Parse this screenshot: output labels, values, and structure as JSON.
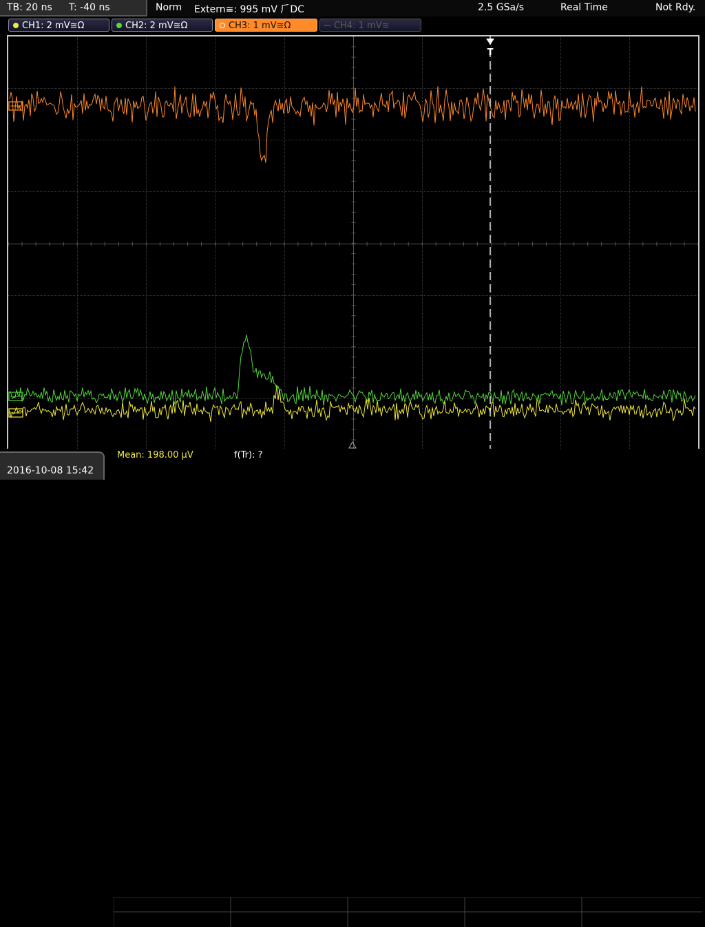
{
  "topbar": {
    "timebase": "TB: 20 ns",
    "trigger_pos": "T: -40 ns",
    "mode": "Norm",
    "trigger_source": "Extern≅: 995 mV ⺁DC",
    "sample_rate": "2.5 GSa/s",
    "acq_mode": "Real Time",
    "status": "Not Rdy."
  },
  "channels": [
    {
      "label": "CH1: 2 mV≅Ω",
      "color": "#f2ea3c",
      "state": "on"
    },
    {
      "label": "CH2: 2 mV≅Ω",
      "color": "#52d93a",
      "state": "on"
    },
    {
      "label": "CH3: 1 mV≅Ω",
      "color": "#ff8a2a",
      "state": "active"
    },
    {
      "label": "CH4: 1 mV≅",
      "color": "#5a5a60",
      "state": "off"
    }
  ],
  "trigger_marker": "T",
  "measurements": {
    "mean": "Mean: 198.00 µV",
    "ftr": "f(Tr): ?"
  },
  "timestamp": "2016-10-08 15:42",
  "colors": {
    "ch3": "#ff8a2a",
    "ch2": "#52d93a",
    "ch1": "#f2ea3c",
    "grid": "#3a3a3a",
    "frame": "#c8c8c8"
  }
}
